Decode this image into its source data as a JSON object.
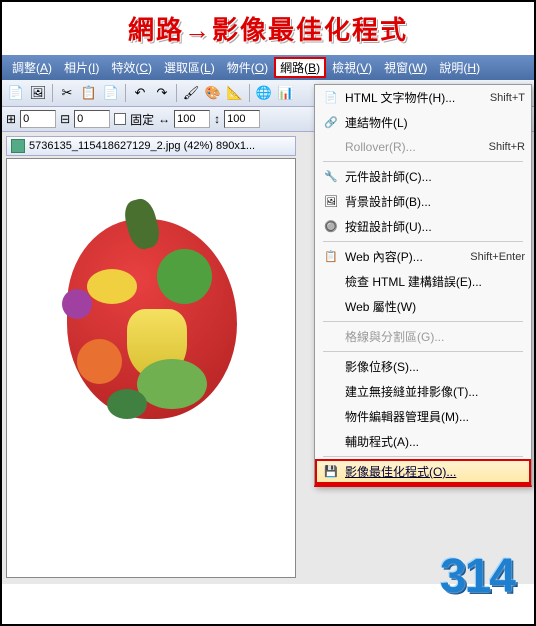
{
  "annotation": {
    "left": "網路",
    "arrow": "→",
    "right": "影像最佳化程式"
  },
  "menubar": [
    {
      "label": "調整",
      "m": "A"
    },
    {
      "label": "相片",
      "m": "I"
    },
    {
      "label": "特效",
      "m": "C"
    },
    {
      "label": "選取區",
      "m": "L"
    },
    {
      "label": "物件",
      "m": "O"
    },
    {
      "label": "網路",
      "m": "B",
      "active": true
    },
    {
      "label": "檢視",
      "m": "V"
    },
    {
      "label": "視窗",
      "m": "W"
    },
    {
      "label": "說明",
      "m": "H"
    }
  ],
  "toolbar2": {
    "x": "0",
    "y": "0",
    "lock": "固定",
    "w": "100",
    "h": "100"
  },
  "doc": {
    "title": "5736135_115418627129_2.jpg (42%) 890x1..."
  },
  "dropdown": [
    {
      "icon": "📄",
      "label": "HTML 文字物件(H)...",
      "shortcut": "Shift+T"
    },
    {
      "icon": "🔗",
      "label": "連結物件(L)"
    },
    {
      "icon": "",
      "label": "Rollover(R)...",
      "shortcut": "Shift+R",
      "disabled": true
    },
    {
      "sep": true
    },
    {
      "icon": "🔧",
      "label": "元件設計師(C)..."
    },
    {
      "icon": "🖼",
      "label": "背景設計師(B)..."
    },
    {
      "icon": "🔘",
      "label": "按鈕設計師(U)..."
    },
    {
      "sep": true
    },
    {
      "icon": "📋",
      "label": "Web 內容(P)...",
      "shortcut": "Shift+Enter"
    },
    {
      "icon": "",
      "label": "檢查 HTML 建構錯誤(E)..."
    },
    {
      "icon": "",
      "label": "Web 屬性(W)"
    },
    {
      "sep": true
    },
    {
      "icon": "",
      "label": "格線與分割區(G)...",
      "disabled": true
    },
    {
      "sep": true
    },
    {
      "icon": "",
      "label": "影像位移(S)..."
    },
    {
      "icon": "",
      "label": "建立無接縫並排影像(T)..."
    },
    {
      "icon": "",
      "label": "物件編輯器管理員(M)..."
    },
    {
      "icon": "",
      "label": "輔助程式(A)..."
    },
    {
      "sep": true
    },
    {
      "icon": "💾",
      "label": "影像最佳化程式(O)...",
      "highlighted": true
    }
  ],
  "logo": "314"
}
